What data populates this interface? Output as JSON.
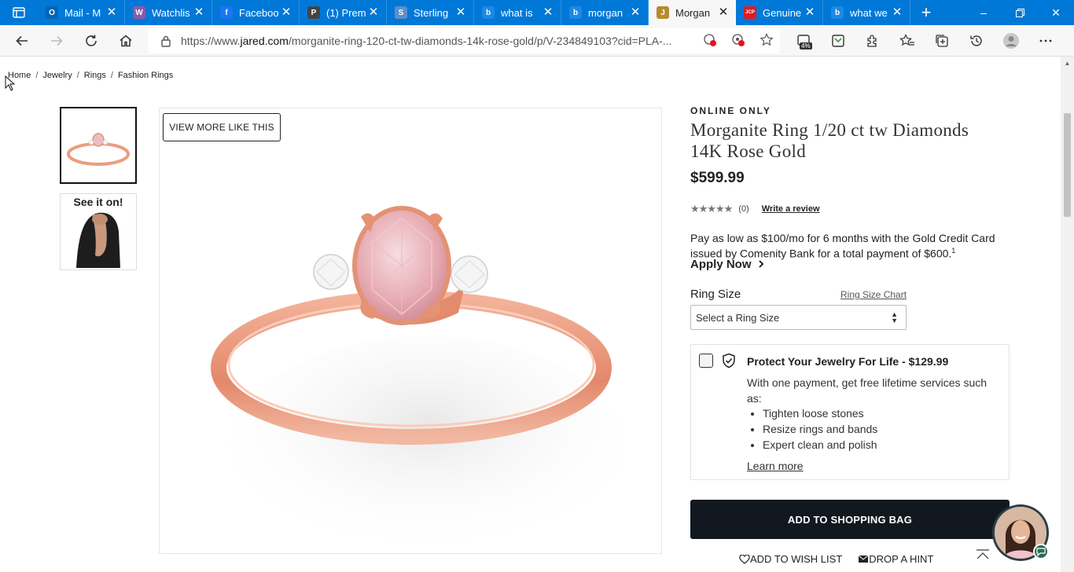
{
  "browser": {
    "tabs": [
      {
        "title": "Mail - M",
        "favicon_color": "#0364b8",
        "favicon_letter": "O",
        "active": false
      },
      {
        "title": "Watchlis",
        "favicon_color": "#8a5aa8",
        "favicon_letter": "W",
        "active": false
      },
      {
        "title": "Faceboo",
        "favicon_color": "#1877f2",
        "favicon_letter": "f",
        "active": false
      },
      {
        "title": "(1) Prem",
        "favicon_color": "#444444",
        "favicon_letter": "P",
        "active": false
      },
      {
        "title": "Sterling",
        "favicon_color": "#5a8fc6",
        "favicon_letter": "S",
        "active": false
      },
      {
        "title": "what is",
        "favicon_color": "#1e88e5",
        "favicon_letter": "b",
        "active": false
      },
      {
        "title": "morgan",
        "favicon_color": "#1e88e5",
        "favicon_letter": "b",
        "active": false
      },
      {
        "title": "Morgan",
        "favicon_color": "#b58b2e",
        "favicon_letter": "J",
        "active": true
      },
      {
        "title": "Genuine",
        "favicon_color": "#e11b22",
        "favicon_letter": "JCP",
        "active": false
      },
      {
        "title": "what we",
        "favicon_color": "#1e88e5",
        "favicon_letter": "b",
        "active": false
      }
    ],
    "url_prefix": "https://www.",
    "url_host": "jared.com",
    "url_path": "/morganite-ring-120-ct-tw-diamonds-14k-rose-gold/p/V-234849103?cid=PLA-...",
    "extension_badge": "4%"
  },
  "breadcrumb": [
    "Home",
    "Jewelry",
    "Rings",
    "Fashion Rings"
  ],
  "gallery": {
    "see_it_on": "See it on!",
    "view_more": "VIEW MORE LIKE THIS"
  },
  "product": {
    "availability": "ONLINE ONLY",
    "title": "Morganite Ring 1/20 ct tw Diamonds 14K Rose Gold",
    "price": "$599.99",
    "rating_stars": "★★★★★",
    "review_count": "(0)",
    "write_review": "Write a review",
    "finance_text": "Pay as low as $100/mo for 6 months with the Gold Credit Card issued by Comenity Bank for a total payment of $600.",
    "finance_footnote": "1",
    "apply_now": "Apply Now",
    "ring_size_label": "Ring Size",
    "ring_size_chart": "Ring Size Chart",
    "ring_size_placeholder": "Select a Ring Size"
  },
  "protection": {
    "title": "Protect Your Jewelry For Life - $129.99",
    "description": "With one payment, get free lifetime services such as:",
    "benefits": [
      "Tighten loose stones",
      "Resize rings and bands",
      "Expert clean and polish"
    ],
    "learn_more": "Learn more"
  },
  "actions": {
    "add_to_bag": "ADD TO SHOPPING BAG",
    "wish_list": "ADD TO WISH LIST",
    "drop_hint": "DROP A HINT"
  },
  "colors": {
    "browser_accent": "#0078d7",
    "cta_dark": "#111820",
    "rose_gold": "#e8957a",
    "morganite": "#e8b4bc"
  }
}
